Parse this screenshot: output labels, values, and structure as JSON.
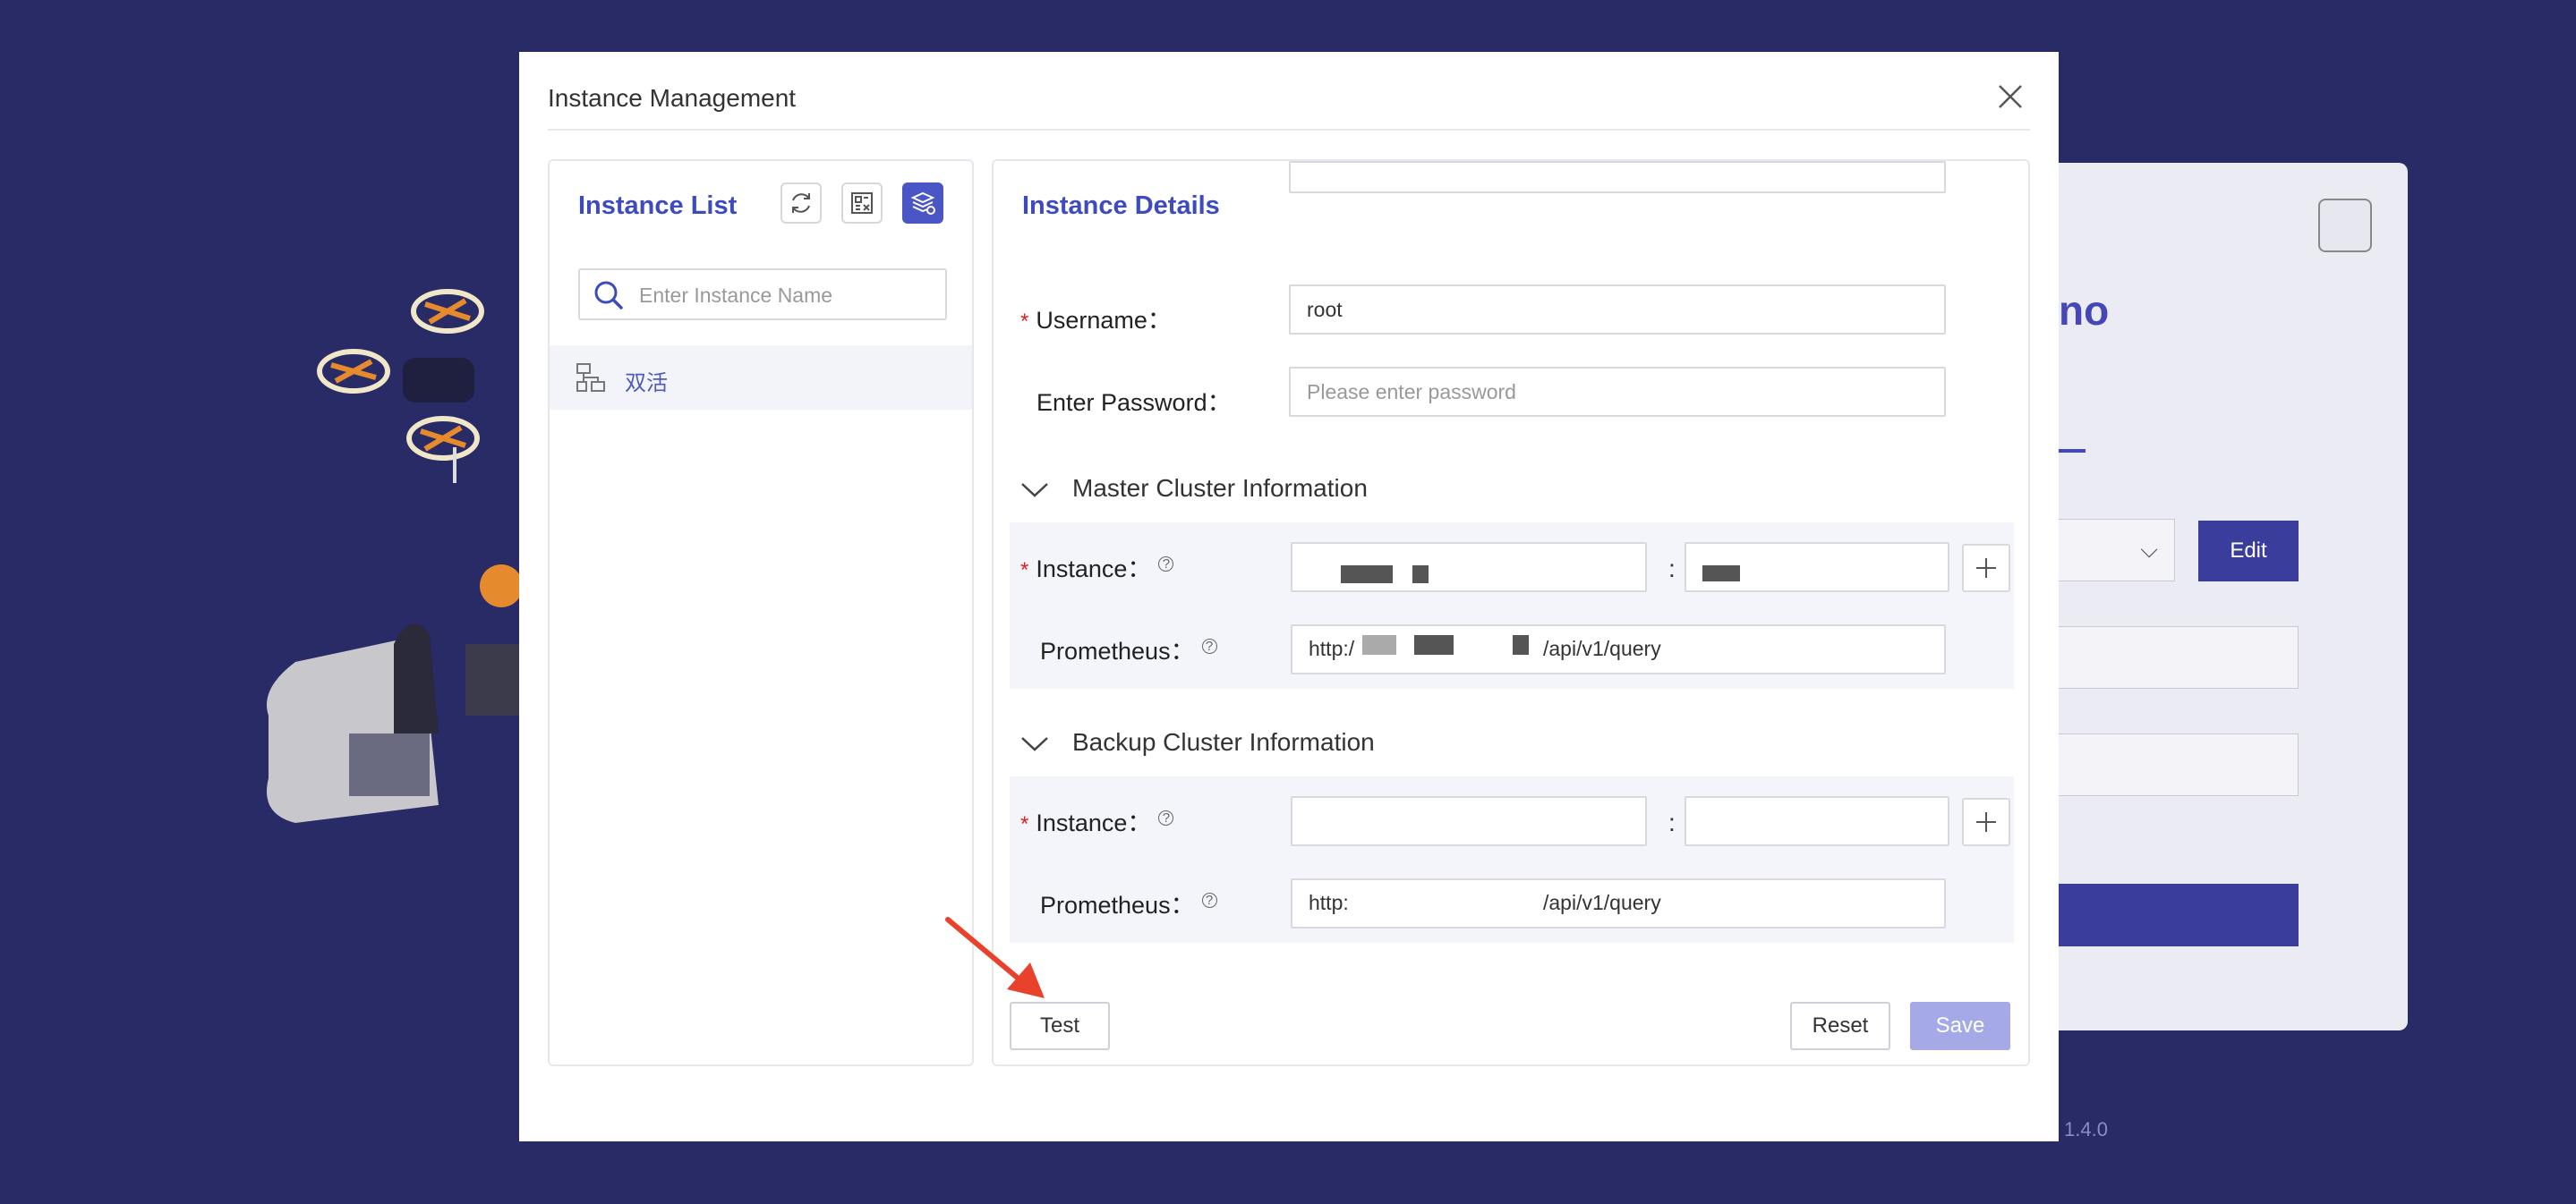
{
  "background": {
    "login_title_fragment": "no",
    "edit_label": "Edit",
    "version": "1.4.0"
  },
  "modal": {
    "title": "Instance Management",
    "close_icon": "close-icon"
  },
  "instance_list": {
    "title": "Instance List",
    "tools": [
      "refresh-icon",
      "import-icon",
      "add-instance-icon"
    ],
    "search": {
      "placeholder": "Enter Instance Name",
      "value": ""
    },
    "items": [
      {
        "label": "双活",
        "icon": "cluster-icon"
      }
    ]
  },
  "details": {
    "title": "Instance Details",
    "username": {
      "label": "Username：",
      "value": "root",
      "required": true
    },
    "password": {
      "label": "Enter Password：",
      "placeholder": "Please enter password",
      "value": ""
    },
    "master": {
      "title": "Master Cluster Information",
      "instance_label": "Instance：",
      "instance_colon": ":",
      "prometheus_label": "Prometheus：",
      "prometheus_prefix": "http:/",
      "prometheus_suffix": "/api/v1/query"
    },
    "backup": {
      "title": "Backup Cluster Information",
      "instance_label": "Instance：",
      "instance_colon": ":",
      "prometheus_label": "Prometheus：",
      "prometheus_prefix": "http:",
      "prometheus_suffix": "/api/v1/query"
    },
    "buttons": {
      "test": "Test",
      "reset": "Reset",
      "save": "Save"
    }
  },
  "colors": {
    "backdrop": "#292b66",
    "accent": "#3e4bbf",
    "save_disabled": "#a5aae6",
    "annotation_arrow": "#e8412c"
  }
}
